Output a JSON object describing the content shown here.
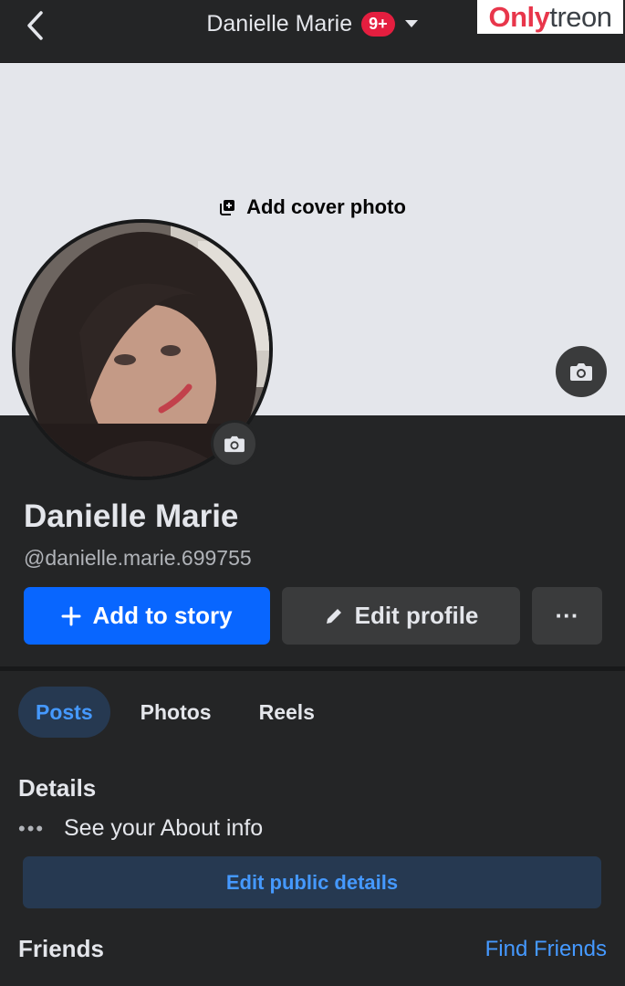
{
  "header": {
    "title": "Danielle Marie",
    "notification_count": "9+",
    "back_icon": "chevron-left-icon",
    "caret_icon": "caret-down-icon"
  },
  "watermark": {
    "part1": "Only",
    "part2": "treon"
  },
  "cover": {
    "add_label": "Add cover photo",
    "add_icon": "photo-add-icon",
    "camera_icon": "camera-icon"
  },
  "profile": {
    "name": "Danielle Marie",
    "username": "@danielle.marie.699755",
    "avatar_camera_icon": "camera-icon"
  },
  "actions": {
    "add_story": "Add to story",
    "edit_profile": "Edit profile",
    "more": "···"
  },
  "tabs": [
    {
      "label": "Posts",
      "active": true
    },
    {
      "label": "Photos",
      "active": false
    },
    {
      "label": "Reels",
      "active": false
    }
  ],
  "details": {
    "title": "Details",
    "about_dots": "•••",
    "about_label": "See your About info",
    "edit_public_label": "Edit public details"
  },
  "friends": {
    "title": "Friends",
    "find_label": "Find Friends"
  },
  "colors": {
    "accent": "#0866ff",
    "link": "#4599ff",
    "badge": "#e41e3f",
    "background": "#242526"
  }
}
